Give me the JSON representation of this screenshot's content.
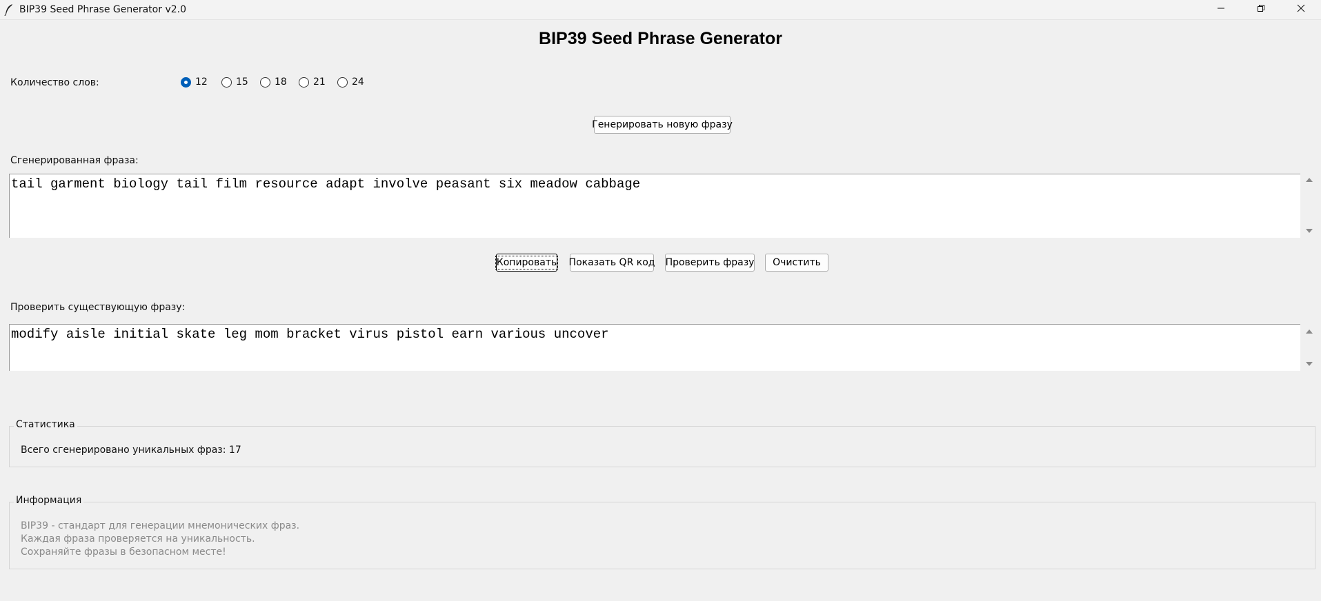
{
  "window": {
    "title": "BIP39 Seed Phrase Generator v2.0",
    "icon": "feather-icon"
  },
  "header": {
    "title": "BIP39 Seed Phrase Generator"
  },
  "word_count": {
    "label": "Количество слов:",
    "options": [
      "12",
      "15",
      "18",
      "21",
      "24"
    ],
    "selected": "12"
  },
  "buttons": {
    "generate": "Генерировать новую фразу",
    "copy": "Копировать",
    "show_qr": "Показать QR код",
    "check": "Проверить фразу",
    "clear": "Очистить"
  },
  "generated": {
    "label": "Сгенерированная фраза:",
    "phrase": "tail garment biology tail film resource adapt involve peasant six meadow cabbage"
  },
  "verify": {
    "label": "Проверить существующую фразу:",
    "phrase": "modify aisle initial skate leg mom bracket virus pistol earn various uncover"
  },
  "stats": {
    "title": "Статистика",
    "text": "Всего сгенерировано уникальных фраз: 17"
  },
  "info": {
    "title": "Информация",
    "lines": [
      "BIP39 - стандарт для генерации мнемонических фраз.",
      "Каждая фраза проверяется на уникальность.",
      "Сохраняйте фразы в безопасном месте!"
    ]
  },
  "colors": {
    "background": "#f0f0f0",
    "radio_selected": "#005fb8",
    "info_text": "#8a8a8a"
  }
}
